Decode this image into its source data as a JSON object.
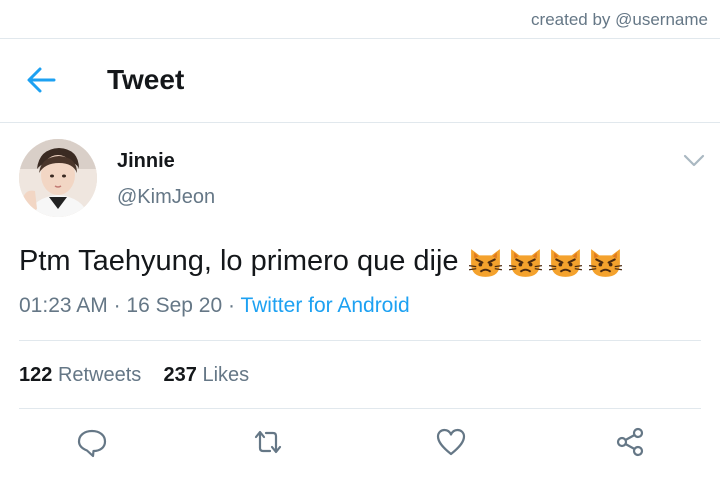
{
  "watermark": "created by @username",
  "header": {
    "title": "Tweet"
  },
  "tweet": {
    "name": "Jinnie",
    "handle": "@KimJeon",
    "text": "Ptm Taehyung, lo primero que dije",
    "emoji_icons": [
      "pouting-cat-emoji",
      "pouting-cat-emoji",
      "pouting-cat-emoji",
      "pouting-cat-emoji"
    ],
    "time": "01:23 AM",
    "date": "16 Sep 20",
    "source": "Twitter for Android",
    "retweets_count": "122",
    "retweets_label": "Retweets",
    "likes_count": "237",
    "likes_label": "Likes"
  },
  "colors": {
    "accent": "#1da1f2",
    "muted": "#657786",
    "text": "#14171a",
    "border": "#e1e8ed"
  }
}
